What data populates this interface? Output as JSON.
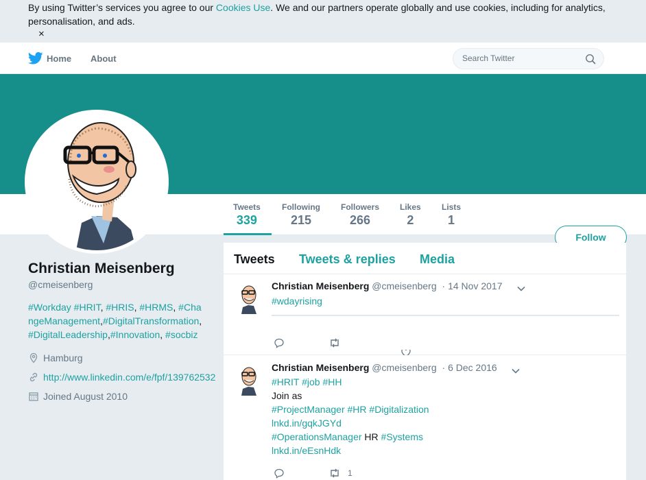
{
  "cookie": {
    "text_before": "By using Twitter’s services you agree to our ",
    "link": "Cookies Use",
    "text_after": ". We and our partners operate globally and use cookies, including for analytics, personalisation, and ads.",
    "close": "×"
  },
  "nav": {
    "home": "Home",
    "about": "About",
    "search_placeholder": "Search Twitter"
  },
  "profile_nav": {
    "stats": [
      {
        "label": "Tweets",
        "value": "339"
      },
      {
        "label": "Following",
        "value": "215"
      },
      {
        "label": "Followers",
        "value": "266"
      },
      {
        "label": "Likes",
        "value": "2"
      },
      {
        "label": "Lists",
        "value": "1"
      }
    ],
    "follow": "Follow"
  },
  "profile": {
    "name": "Christian Meisenberg",
    "handle": "@cmeisenberg",
    "bio": [
      {
        "t": "#Workday",
        "tag": true
      },
      {
        "t": " ",
        "tag": false
      },
      {
        "t": "#HRIT",
        "tag": true
      },
      {
        "t": ", ",
        "tag": false
      },
      {
        "t": "#HRIS",
        "tag": true
      },
      {
        "t": ", ",
        "tag": false
      },
      {
        "t": "#HRMS",
        "tag": true
      },
      {
        "t": ", ",
        "tag": false
      },
      {
        "t": "#ChangeManagement",
        "tag": true
      },
      {
        "t": ",",
        "tag": false
      },
      {
        "t": "#DigitalTransformation",
        "tag": true
      },
      {
        "t": ",",
        "tag": false
      },
      {
        "t": "#DigitalLeadership",
        "tag": true
      },
      {
        "t": ",",
        "tag": false
      },
      {
        "t": "#Innovation",
        "tag": true
      },
      {
        "t": ", ",
        "tag": false
      },
      {
        "t": "#socbiz",
        "tag": true
      }
    ],
    "location": "Hamburg",
    "url": "http://www.linkedin.com/e/fpf/139762532",
    "joined": "Joined August 2010"
  },
  "timeline": {
    "tabs": [
      "Tweets",
      "Tweets & replies",
      "Media"
    ],
    "tweets": [
      {
        "name": "Christian Meisenberg",
        "handle": "@cmeisenberg",
        "date": "· 14 Nov 2017",
        "lines": [
          [
            {
              "t": "#wdayrising",
              "tag": true
            }
          ]
        ],
        "retweets": ""
      },
      {
        "name": "Christian Meisenberg",
        "handle": "@cmeisenberg",
        "date": "· 6 Dec 2016",
        "lines": [
          [
            {
              "t": "#HRIT",
              "tag": true
            },
            {
              "t": " ",
              "tag": false
            },
            {
              "t": "#job",
              "tag": true
            },
            {
              "t": " ",
              "tag": false
            },
            {
              "t": "#HH",
              "tag": true
            }
          ],
          [
            {
              "t": "Join as",
              "tag": false
            }
          ],
          [
            {
              "t": "#ProjectManager",
              "tag": true
            },
            {
              "t": " ",
              "tag": false
            },
            {
              "t": "#HR",
              "tag": true
            },
            {
              "t": " ",
              "tag": false
            },
            {
              "t": "#Digitalization",
              "tag": true
            }
          ],
          [
            {
              "t": "lnkd.in/gqkJGYd",
              "tag": true
            }
          ],
          [
            {
              "t": "#OperationsManager",
              "tag": true
            },
            {
              "t": " HR ",
              "tag": false
            },
            {
              "t": "#Systems",
              "tag": true
            }
          ],
          [
            {
              "t": "lnkd.in/eEsnHdk",
              "tag": true
            }
          ]
        ],
        "retweets": "1"
      }
    ]
  },
  "colors": {
    "accent": "#1da1a1",
    "banner": "#168e8a"
  }
}
